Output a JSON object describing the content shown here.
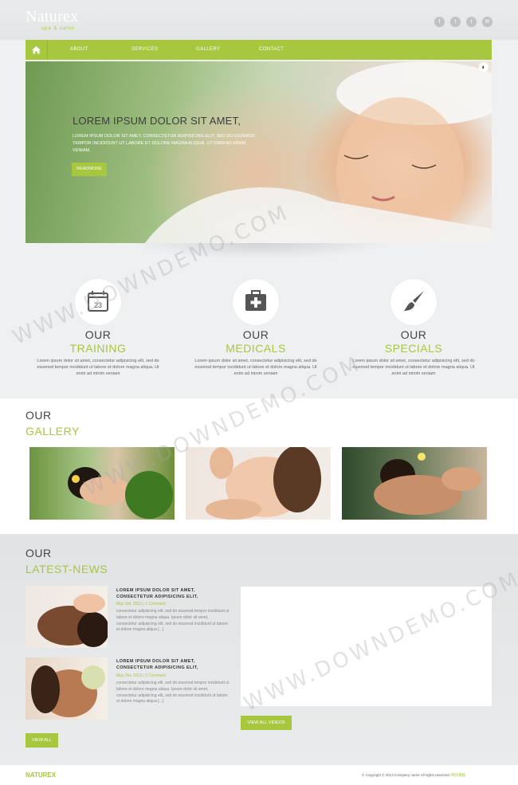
{
  "header": {
    "logo": "Naturex",
    "logo_sub": "spa & salon",
    "social_icons": [
      "facebook-icon",
      "twitter-icon",
      "tumblr-icon",
      "email-icon"
    ]
  },
  "nav": {
    "items": [
      {
        "label": "ABOUT"
      },
      {
        "label": "SERVICES"
      },
      {
        "label": "GALLERY"
      },
      {
        "label": "CONTACT"
      }
    ]
  },
  "hero": {
    "title": "LOREM IPSUM DOLOR SIT AMET,",
    "text": "LOREM IPSUM DOLOR SIT AMET, CONSECTETUR ADIPISICING ELIT, SED DO EIUSMOD TEMPOR INCIDIDUNT UT LABORE ET DOLORE MAGNA ALIQUA. UT ENIM AD MINIM VENIAM,",
    "button": "READMORE"
  },
  "features": [
    {
      "our": "OUR",
      "name": "TRAINING",
      "icon": "calendar-icon",
      "icon_text": "23",
      "text": "Lorem ipsum dolor sit amet, consectetur adipisicing elit, sed do eiusmod tempor incididunt ut labore et dolore magna aliqua. Ut enim ad minim veniam"
    },
    {
      "our": "OUR",
      "name": "MEDICALS",
      "icon": "medical-kit-icon",
      "text": "Lorem ipsum dolor sit amet, consectetur adipisicing elit, sed do eiusmod tempor incididunt ut labore et dolore magna aliqua. Ut enim ad minim veniam"
    },
    {
      "our": "OUR",
      "name": "SPECIALS",
      "icon": "brush-icon",
      "text": "Lorem ipsum dolor sit amet, consectetur adipisicing elit, sed do eiusmod tempor incididunt ut labore et dolore magna aliqua. Ut enim ad minim veniam"
    }
  ],
  "gallery": {
    "our": "OUR",
    "name": "GALLERY"
  },
  "news": {
    "our": "OUR",
    "name": "LATEST-NEWS",
    "items": [
      {
        "title": "LOREM IPSUM DOLOR SIT AMET, CONSECTETUR ADIPISICING ELIT,",
        "date": "May 3rd, 2013 | 1 Comment",
        "text": "consectetur adipisicing elit, sed do eiusmod tempor incididunt ut labore et dolore magna aliqua. Ipsum dolor sit amet, consectetur adipisicing elit, sed do eiusmod incididunt ut labore et dolore magna aliqua [...]"
      },
      {
        "title": "LOREM IPSUM DOLOR SIT AMET, CONSECTETUR ADIPISICING ELIT,",
        "date": "May 3rd, 2013 | 1 Comment",
        "text": "consectetur adipisicing elit, sed do eiusmod tempor incididunt ut labore et dolore magna aliqua. Ipsum dolor sit amet, consectetur adipisicing elit, sed do eiusmod incididunt ut labore et dolore magna aliqua [...]"
      }
    ],
    "view_all": "VIEW ALL",
    "view_all_videos": "VIEW ALL VIDEOS"
  },
  "footer": {
    "logo": "NATUREX",
    "copyright": "© Copyright © 2013.Company name All rights reserved.",
    "copyright_link": "网页模板"
  },
  "watermark": "WWW.DOWNDEMO.COM"
}
